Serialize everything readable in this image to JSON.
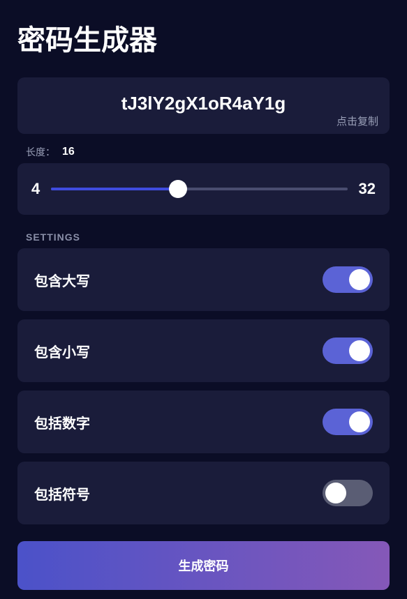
{
  "title": "密码生成器",
  "password": {
    "value": "tJ3lY2gX1oR4aY1g",
    "copy_hint": "点击复制"
  },
  "length": {
    "label": "长度：",
    "value": "16",
    "min": "4",
    "max": "32"
  },
  "settings_header": "SETTINGS",
  "settings": {
    "uppercase": {
      "label": "包含大写",
      "enabled": true
    },
    "lowercase": {
      "label": "包含小写",
      "enabled": true
    },
    "numbers": {
      "label": "包括数字",
      "enabled": true
    },
    "symbols": {
      "label": "包括符号",
      "enabled": false
    }
  },
  "generate_button": "生成密码"
}
